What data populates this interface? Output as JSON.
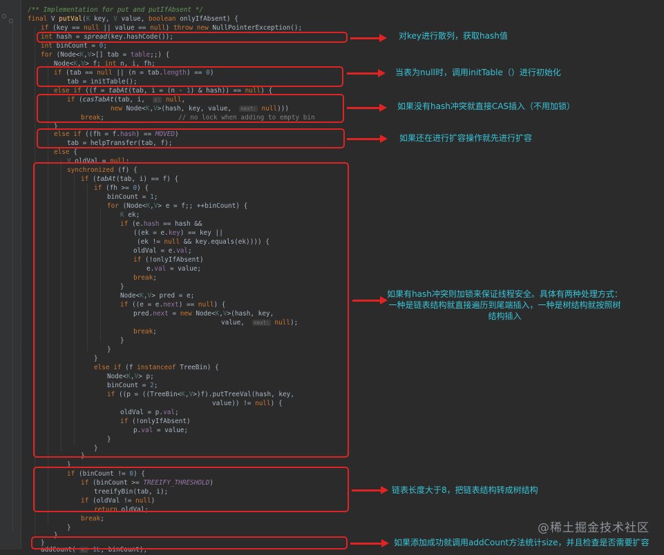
{
  "editor": {
    "lines": [
      "/** Implementation for put and putIfAbsent */",
      "final V putVal(K key, V value, boolean onlyIfAbsent) {",
      "if (key == null || value == null) throw new NullPointerException();",
      "int hash = spread(key.hashCode());",
      "int binCount = 0;",
      "for (Node<K,V>[] tab = table;;) {",
      "Node<K,V> f; int n, i, fh;",
      "if (tab == null || (n = tab.length) == 0)",
      "tab = initTable();",
      "else if ((f = tabAt(tab, i = (n - 1) & hash)) == null) {",
      "if (casTabAt(tab, i,   c: null,",
      "new Node<K,V>(hash, key, value,   next: null)))",
      "break;                   // no lock when adding to empty bin",
      "}",
      "else if ((fh = f.hash) == MOVED)",
      "tab = helpTransfer(tab, f);",
      "else {",
      "V oldVal = null;",
      "synchronized (f) {",
      "if (tabAt(tab, i) == f) {",
      "if (fh >= 0) {",
      "binCount = 1;",
      "for (Node<K,V> e = f;; ++binCount) {",
      "K ek;",
      "if (e.hash == hash &&",
      "((ek = e.key) == key ||",
      "(ek != null && key.equals(ek)))) {",
      "oldVal = e.val;",
      "if (!onlyIfAbsent)",
      "e.val = value;",
      "break;",
      "}",
      "Node<K,V> pred = e;",
      "if ((e = e.next) == null) {",
      "pred.next = new Node<K,V>(hash, key,",
      "value,   next: null);",
      "break;",
      "}",
      "}",
      "}",
      "else if (f instanceof TreeBin) {",
      "Node<K,V> p;",
      "binCount = 2;",
      "if ((p = ((TreeBin<K,V>)f).putTreeVal(hash, key,",
      "value)) != null) {",
      "oldVal = p.val;",
      "if (!onlyIfAbsent)",
      "p.val = value;",
      "}",
      "}",
      "}",
      "}",
      "if (binCount != 0) {",
      "if (binCount >= TREEIFY_THRESHOLD)",
      "treeifyBin(tab, i);",
      "if (oldVal != null)",
      "return oldVal;",
      "break;",
      "}",
      "}",
      "}",
      "addCount(  x: 1L, binCount);"
    ]
  },
  "annotations": {
    "a1": "对key进行散列，获取hash值",
    "a2": "当表为null时，调用initTable（）进行初始化",
    "a3": "如果没有hash冲突就直接CAS插入（不用加锁）",
    "a4": "如果还在进行扩容操作就先进行扩容",
    "a5_line1": "如果有hash冲突则加锁来保证线程安全。具体有两种处理方式：",
    "a5_line2": "一种是链表结构就直接遍历到尾端插入，一种是树结构就按照树",
    "a5_line3": "结构插入",
    "a6": "链表长度大于8，把链表结构转成树结构",
    "a7": "如果添加成功就调用addCount方法统计size，并且检查是否需要扩容"
  },
  "watermark": "@稀土掘金技术社区",
  "colors": {
    "background": "#2b2b2b",
    "highlight_box": "#e02424",
    "annotation_text": "#38c4d8",
    "keyword": "#cc7832",
    "comment": "#629755",
    "method": "#ffc66d",
    "field": "#9876aa"
  }
}
